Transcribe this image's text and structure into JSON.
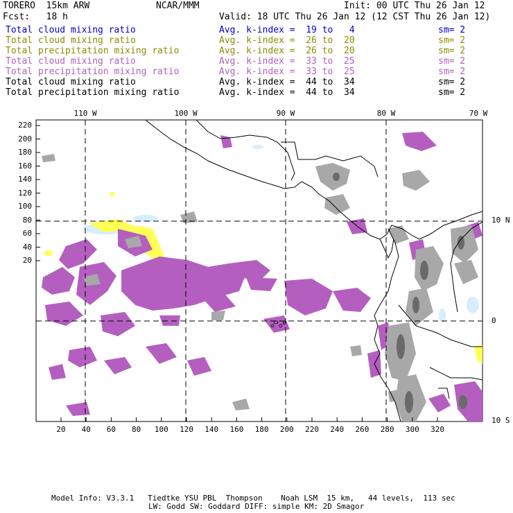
{
  "header": {
    "model": "TORERO  15km ARW",
    "org": "NCAR/MMM",
    "init": "Init: 00 UTC Thu 26 Jan 12",
    "fcst": "Fcst:   18 h",
    "valid": "Valid: 18 UTC Thu 26 Jan 12 (12 CST Thu 26 Jan 12)"
  },
  "legend": [
    {
      "field": "Total cloud mixing ratio",
      "kidx": "Avg. k-index =  19 to   4",
      "sm": "sm= 2",
      "color": "#0000cc"
    },
    {
      "field": "Total cloud mixing ratio",
      "kidx": "Avg. k-index =  26 to  20",
      "sm": "sm= 2",
      "color": "#8c8c00"
    },
    {
      "field": "Total precipitation mixing ratio",
      "kidx": "Avg. k-index =  26 to  20",
      "sm": "sm= 2",
      "color": "#8c8c00"
    },
    {
      "field": "Total cloud mixing ratio",
      "kidx": "Avg. k-index =  33 to  25",
      "sm": "sm= 2",
      "color": "#b060c0"
    },
    {
      "field": "Total precipitation mixing ratio",
      "kidx": "Avg. k-index =  33 to  25",
      "sm": "sm= 2",
      "color": "#b060c0"
    },
    {
      "field": "Total cloud mixing ratio",
      "kidx": "Avg. k-index =  44 to  34",
      "sm": "sm= 2",
      "color": "#000000"
    },
    {
      "field": "Total precipitation mixing ratio",
      "kidx": "Avg. k-index =  44 to  34",
      "sm": "sm= 2",
      "color": "#000000"
    }
  ],
  "axes": {
    "left_ticks": [
      "220",
      "200",
      "180",
      "160",
      "140",
      "120",
      "100",
      "80",
      "60",
      "40",
      "20"
    ],
    "bottom_ticks": [
      "20",
      "40",
      "60",
      "80",
      "100",
      "120",
      "140",
      "160",
      "180",
      "200",
      "220",
      "240",
      "260",
      "280",
      "300",
      "320"
    ],
    "lon_labels": [
      "110 W",
      "100 W",
      "90 W",
      "80 W",
      "70 W"
    ],
    "lat_labels": [
      "10 N",
      "0",
      "10 S"
    ]
  },
  "footer": {
    "line1": "Model Info: V3.3.1   Tiedtke YSU PBL  Thompson    Noah LSM  15 km,   44 levels,  113 sec",
    "line2": "LW: Godd SW: Goddard DIFF: simple KM: 2D Smagor"
  },
  "colors": {
    "purple": "#b45fbf",
    "gray": "#a0a0a0",
    "darkgray": "#6a6a6a",
    "yellow": "#ffff55",
    "cyan": "#d8f0ff"
  }
}
